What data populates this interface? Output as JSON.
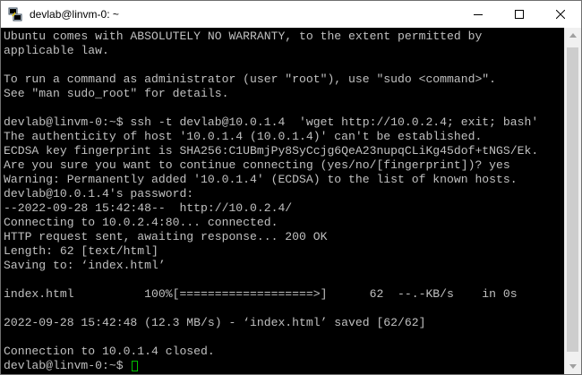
{
  "window": {
    "title": "devlab@linvm-0: ~",
    "app_icon": "putty-icon",
    "controls": {
      "minimize_icon": "minimize-icon",
      "maximize_icon": "maximize-icon",
      "close_icon": "close-icon"
    }
  },
  "terminal": {
    "lines": [
      "Ubuntu comes with ABSOLUTELY NO WARRANTY, to the extent permitted by",
      "applicable law.",
      "",
      "To run a command as administrator (user \"root\"), use \"sudo <command>\".",
      "See \"man sudo_root\" for details.",
      "",
      "devlab@linvm-0:~$ ssh -t devlab@10.0.1.4  'wget http://10.0.2.4; exit; bash'",
      "The authenticity of host '10.0.1.4 (10.0.1.4)' can't be established.",
      "ECDSA key fingerprint is SHA256:C1UBmjPy8SyCcjg6QeA23nupqCLiKg45dof+tNGS/Ek.",
      "Are you sure you want to continue connecting (yes/no/[fingerprint])? yes",
      "Warning: Permanently added '10.0.1.4' (ECDSA) to the list of known hosts.",
      "devlab@10.0.1.4's password:",
      "--2022-09-28 15:42:48--  http://10.0.2.4/",
      "Connecting to 10.0.2.4:80... connected.",
      "HTTP request sent, awaiting response... 200 OK",
      "Length: 62 [text/html]",
      "Saving to: ‘index.html’",
      "",
      "index.html          100%[===================>]      62  --.-KB/s    in 0s",
      "",
      "2022-09-28 15:42:48 (12.3 MB/s) - ‘index.html’ saved [62/62]",
      "",
      "Connection to 10.0.1.4 closed."
    ],
    "prompt": "devlab@linvm-0:~$ "
  },
  "colors": {
    "terminal_bg": "#000000",
    "terminal_text": "#c0c0c0",
    "cursor": "#00c000",
    "titlebar_bg": "#ffffff"
  }
}
